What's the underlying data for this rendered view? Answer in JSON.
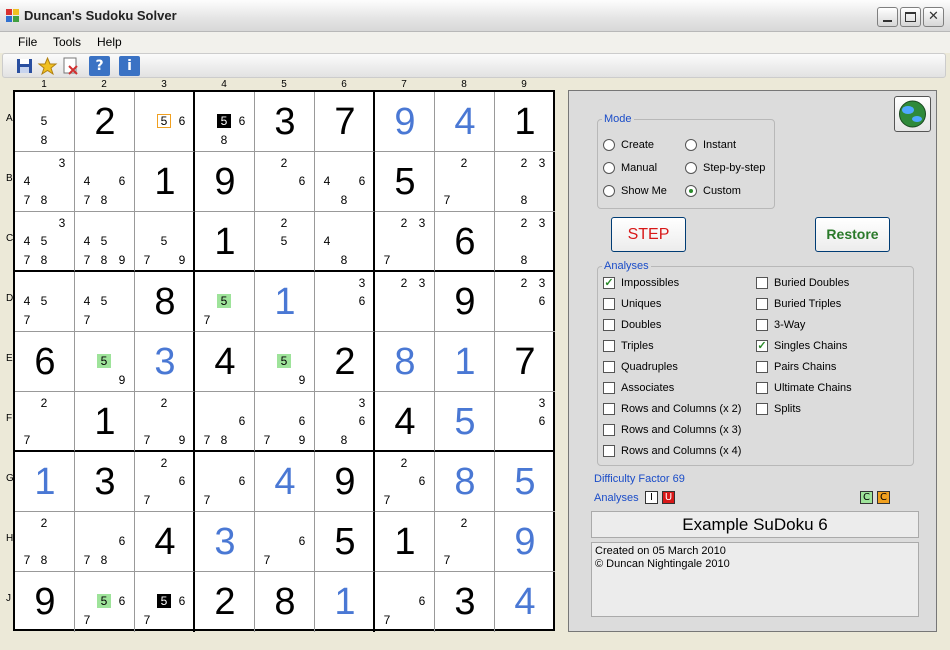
{
  "window": {
    "title": "Duncan's Sudoku Solver"
  },
  "menu": [
    "File",
    "Tools",
    "Help"
  ],
  "toolbar": [
    {
      "icon": "save-icon"
    },
    {
      "icon": "star-icon"
    },
    {
      "icon": "document-icon"
    },
    {
      "icon": "help-icon",
      "label": "?"
    },
    {
      "icon": "info-icon",
      "label": "i"
    }
  ],
  "columns": [
    "1",
    "2",
    "3",
    "4",
    "5",
    "6",
    "7",
    "8",
    "9"
  ],
  "rows": [
    "A",
    "B",
    "C",
    "D",
    "E",
    "F",
    "G",
    "H",
    "J"
  ],
  "grid": [
    [
      {
        "c": [
          {
            "n": 5,
            "p": 5
          },
          {
            "n": 8,
            "p": 8
          }
        ]
      },
      {
        "v": "2",
        "t": "given"
      },
      {
        "c": [
          {
            "n": 5,
            "p": 5,
            "s": "box"
          },
          {
            "n": 6,
            "p": 6
          }
        ]
      },
      {
        "c": [
          {
            "n": 5,
            "p": 5,
            "s": "inv"
          },
          {
            "n": 6,
            "p": 6
          },
          {
            "n": 8,
            "p": 8
          }
        ]
      },
      {
        "v": "3",
        "t": "given"
      },
      {
        "v": "7",
        "t": "given"
      },
      {
        "v": "9",
        "t": "solved"
      },
      {
        "v": "4",
        "t": "solved"
      },
      {
        "v": "1",
        "t": "given"
      }
    ],
    [
      {
        "c": [
          {
            "n": 3,
            "p": 3
          },
          {
            "n": 4,
            "p": 4
          },
          {
            "n": 7,
            "p": 7
          },
          {
            "n": 8,
            "p": 8
          }
        ]
      },
      {
        "c": [
          {
            "n": 4,
            "p": 4
          },
          {
            "n": 6,
            "p": 6
          },
          {
            "n": 7,
            "p": 7
          },
          {
            "n": 8,
            "p": 8
          }
        ]
      },
      {
        "v": "1",
        "t": "given"
      },
      {
        "v": "9",
        "t": "given"
      },
      {
        "c": [
          {
            "n": 2,
            "p": 2
          },
          {
            "n": 6,
            "p": 6
          }
        ]
      },
      {
        "c": [
          {
            "n": 4,
            "p": 4
          },
          {
            "n": 6,
            "p": 6
          },
          {
            "n": 8,
            "p": 8
          }
        ]
      },
      {
        "v": "5",
        "t": "given"
      },
      {
        "c": [
          {
            "n": 2,
            "p": 2
          },
          {
            "n": 7,
            "p": 7
          }
        ]
      },
      {
        "c": [
          {
            "n": 2,
            "p": 2
          },
          {
            "n": 3,
            "p": 3
          },
          {
            "n": 8,
            "p": 8
          }
        ]
      }
    ],
    [
      {
        "c": [
          {
            "n": 3,
            "p": 3
          },
          {
            "n": 4,
            "p": 4
          },
          {
            "n": 5,
            "p": 5
          },
          {
            "n": 7,
            "p": 7
          },
          {
            "n": 8,
            "p": 8
          }
        ]
      },
      {
        "c": [
          {
            "n": 4,
            "p": 4
          },
          {
            "n": 5,
            "p": 5
          },
          {
            "n": 7,
            "p": 7
          },
          {
            "n": 8,
            "p": 8
          },
          {
            "n": 9,
            "p": 9
          }
        ]
      },
      {
        "c": [
          {
            "n": 5,
            "p": 5
          },
          {
            "n": 7,
            "p": 7
          },
          {
            "n": 9,
            "p": 9
          }
        ]
      },
      {
        "v": "1",
        "t": "given"
      },
      {
        "c": [
          {
            "n": 2,
            "p": 2
          },
          {
            "n": 5,
            "p": 5
          }
        ]
      },
      {
        "c": [
          {
            "n": 4,
            "p": 4
          },
          {
            "n": 8,
            "p": 8
          }
        ]
      },
      {
        "c": [
          {
            "n": 2,
            "p": 2
          },
          {
            "n": 3,
            "p": 3
          },
          {
            "n": 7,
            "p": 7
          }
        ]
      },
      {
        "v": "6",
        "t": "given"
      },
      {
        "c": [
          {
            "n": 2,
            "p": 2
          },
          {
            "n": 3,
            "p": 3
          },
          {
            "n": 8,
            "p": 8
          }
        ]
      }
    ],
    [
      {
        "c": [
          {
            "n": 4,
            "p": 4
          },
          {
            "n": 5,
            "p": 5
          },
          {
            "n": 7,
            "p": 7
          }
        ]
      },
      {
        "c": [
          {
            "n": 4,
            "p": 4
          },
          {
            "n": 5,
            "p": 5
          },
          {
            "n": 7,
            "p": 7
          }
        ]
      },
      {
        "v": "8",
        "t": "given"
      },
      {
        "c": [
          {
            "n": 5,
            "p": 5,
            "s": "hl"
          },
          {
            "n": 7,
            "p": 7
          }
        ]
      },
      {
        "v": "1",
        "t": "solved"
      },
      {
        "c": [
          {
            "n": 3,
            "p": 3
          },
          {
            "n": 6,
            "p": 6
          }
        ]
      },
      {
        "c": [
          {
            "n": 2,
            "p": 2
          },
          {
            "n": 3,
            "p": 3
          }
        ]
      },
      {
        "v": "9",
        "t": "given"
      },
      {
        "c": [
          {
            "n": 2,
            "p": 2
          },
          {
            "n": 3,
            "p": 3
          },
          {
            "n": 6,
            "p": 6
          }
        ]
      }
    ],
    [
      {
        "v": "6",
        "t": "given"
      },
      {
        "c": [
          {
            "n": 5,
            "p": 5,
            "s": "hl"
          },
          {
            "n": 9,
            "p": 9
          }
        ]
      },
      {
        "v": "3",
        "t": "solved"
      },
      {
        "v": "4",
        "t": "given"
      },
      {
        "c": [
          {
            "n": 5,
            "p": 5,
            "s": "hl"
          },
          {
            "n": 9,
            "p": 9
          }
        ]
      },
      {
        "v": "2",
        "t": "given"
      },
      {
        "v": "8",
        "t": "solved"
      },
      {
        "v": "1",
        "t": "solved"
      },
      {
        "v": "7",
        "t": "given"
      }
    ],
    [
      {
        "c": [
          {
            "n": 2,
            "p": 2
          },
          {
            "n": 7,
            "p": 7
          }
        ]
      },
      {
        "v": "1",
        "t": "given"
      },
      {
        "c": [
          {
            "n": 2,
            "p": 2
          },
          {
            "n": 7,
            "p": 7
          },
          {
            "n": 9,
            "p": 9
          }
        ]
      },
      {
        "c": [
          {
            "n": 6,
            "p": 6
          },
          {
            "n": 7,
            "p": 7
          },
          {
            "n": 8,
            "p": 8
          }
        ]
      },
      {
        "c": [
          {
            "n": 6,
            "p": 6
          },
          {
            "n": 7,
            "p": 7
          },
          {
            "n": 9,
            "p": 9
          }
        ]
      },
      {
        "c": [
          {
            "n": 3,
            "p": 3
          },
          {
            "n": 6,
            "p": 6
          },
          {
            "n": 8,
            "p": 8
          }
        ]
      },
      {
        "v": "4",
        "t": "given"
      },
      {
        "v": "5",
        "t": "solved"
      },
      {
        "c": [
          {
            "n": 3,
            "p": 3
          },
          {
            "n": 6,
            "p": 6
          }
        ]
      }
    ],
    [
      {
        "v": "1",
        "t": "solved"
      },
      {
        "v": "3",
        "t": "given"
      },
      {
        "c": [
          {
            "n": 2,
            "p": 2
          },
          {
            "n": 6,
            "p": 6
          },
          {
            "n": 7,
            "p": 7
          }
        ]
      },
      {
        "c": [
          {
            "n": 6,
            "p": 6
          },
          {
            "n": 7,
            "p": 7
          }
        ]
      },
      {
        "v": "4",
        "t": "solved"
      },
      {
        "v": "9",
        "t": "given"
      },
      {
        "c": [
          {
            "n": 2,
            "p": 2
          },
          {
            "n": 6,
            "p": 6
          },
          {
            "n": 7,
            "p": 7
          }
        ]
      },
      {
        "v": "8",
        "t": "solved"
      },
      {
        "v": "5",
        "t": "solved"
      }
    ],
    [
      {
        "c": [
          {
            "n": 2,
            "p": 2
          },
          {
            "n": 7,
            "p": 7
          },
          {
            "n": 8,
            "p": 8
          }
        ]
      },
      {
        "c": [
          {
            "n": 6,
            "p": 6
          },
          {
            "n": 7,
            "p": 7
          },
          {
            "n": 8,
            "p": 8
          }
        ]
      },
      {
        "v": "4",
        "t": "given"
      },
      {
        "v": "3",
        "t": "solved"
      },
      {
        "c": [
          {
            "n": 6,
            "p": 6
          },
          {
            "n": 7,
            "p": 7
          }
        ]
      },
      {
        "v": "5",
        "t": "given"
      },
      {
        "v": "1",
        "t": "given"
      },
      {
        "c": [
          {
            "n": 2,
            "p": 2
          },
          {
            "n": 7,
            "p": 7
          }
        ]
      },
      {
        "v": "9",
        "t": "solved"
      }
    ],
    [
      {
        "v": "9",
        "t": "given"
      },
      {
        "c": [
          {
            "n": 5,
            "p": 5,
            "s": "hl"
          },
          {
            "n": 6,
            "p": 6
          },
          {
            "n": 7,
            "p": 7
          }
        ]
      },
      {
        "c": [
          {
            "n": 5,
            "p": 5,
            "s": "inv"
          },
          {
            "n": 6,
            "p": 6
          },
          {
            "n": 7,
            "p": 7
          }
        ]
      },
      {
        "v": "2",
        "t": "given"
      },
      {
        "v": "8",
        "t": "given"
      },
      {
        "v": "1",
        "t": "solved"
      },
      {
        "c": [
          {
            "n": 6,
            "p": 6
          },
          {
            "n": 7,
            "p": 7
          }
        ]
      },
      {
        "v": "3",
        "t": "given"
      },
      {
        "v": "4",
        "t": "solved"
      }
    ]
  ],
  "mode": {
    "legend": "Mode",
    "options": [
      {
        "label": "Create",
        "selected": false
      },
      {
        "label": "Instant",
        "selected": false
      },
      {
        "label": "Manual",
        "selected": false
      },
      {
        "label": "Step-by-step",
        "selected": false
      },
      {
        "label": "Show Me",
        "selected": false
      },
      {
        "label": "Custom",
        "selected": true
      }
    ]
  },
  "buttons": {
    "step": "STEP",
    "restore": "Restore"
  },
  "analyses": {
    "legend": "Analyses",
    "left": [
      {
        "label": "Impossibles",
        "checked": true
      },
      {
        "label": "Uniques",
        "checked": false
      },
      {
        "label": "Doubles",
        "checked": false
      },
      {
        "label": "Triples",
        "checked": false
      },
      {
        "label": "Quadruples",
        "checked": false
      },
      {
        "label": "Associates",
        "checked": false
      },
      {
        "label": "Rows and Columns (x 2)",
        "checked": false
      },
      {
        "label": "Rows and Columns (x 3)",
        "checked": false
      },
      {
        "label": "Rows and Columns (x 4)",
        "checked": false
      }
    ],
    "right": [
      {
        "label": "Buried Doubles",
        "checked": false
      },
      {
        "label": "Buried Triples",
        "checked": false
      },
      {
        "label": "3-Way",
        "checked": false
      },
      {
        "label": "Singles Chains",
        "checked": true
      },
      {
        "label": "Pairs Chains",
        "checked": false
      },
      {
        "label": "Ultimate Chains",
        "checked": false
      },
      {
        "label": "Splits",
        "checked": false
      }
    ]
  },
  "difficulty": "Difficulty Factor 69",
  "analyses_link": "Analyses",
  "markers_left": [
    {
      "label": "I",
      "color": "#ffffff",
      "text": "#000000"
    },
    {
      "label": "U",
      "color": "#d81818",
      "text": "#ffffff"
    }
  ],
  "markers_right": [
    {
      "label": "C",
      "color": "#9ee39a",
      "text": "#000000"
    },
    {
      "label": "C",
      "color": "#f0a020",
      "text": "#000000"
    }
  ],
  "puzzle_name": "Example SuDoku 6",
  "notes": [
    "Created on 05 March 2010",
    "© Duncan Nightingale 2010"
  ]
}
